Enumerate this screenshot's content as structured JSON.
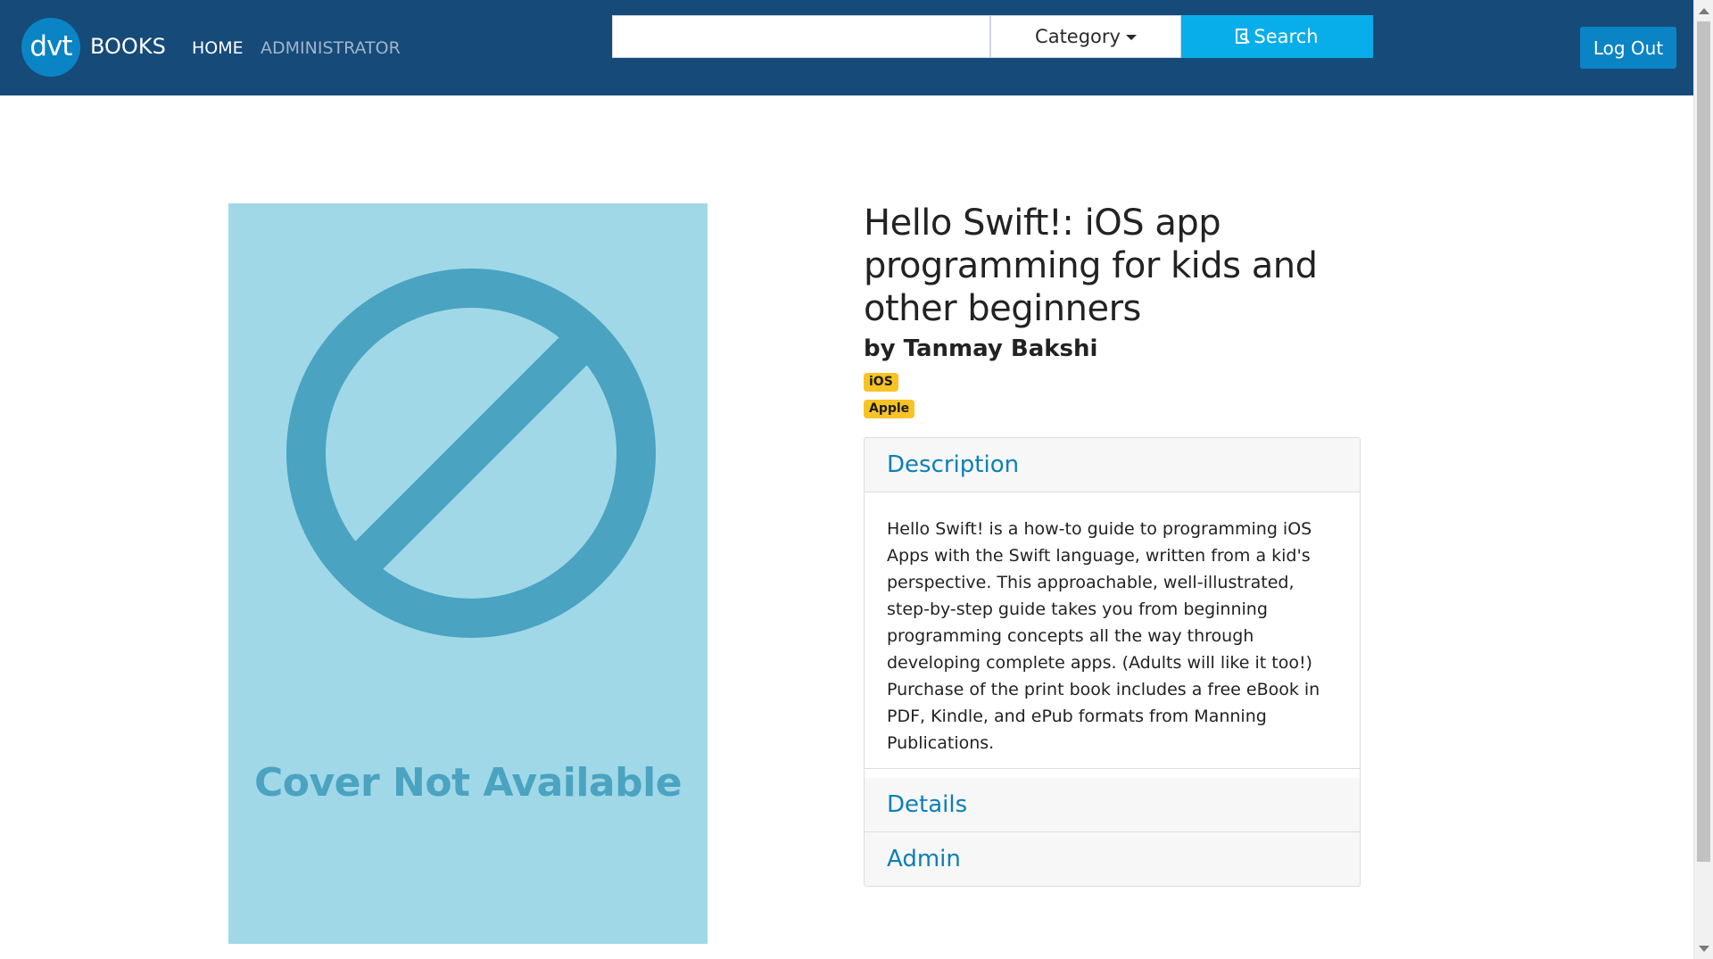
{
  "navbar": {
    "logo_text": "dvt",
    "brand": "BOOKS",
    "links": [
      {
        "label": "HOME"
      },
      {
        "label": "ADMINISTRATOR"
      }
    ],
    "search": {
      "value": "",
      "placeholder": "",
      "category_label": "Category",
      "button_label": "Search"
    },
    "logout_label": "Log Out",
    "colors": {
      "background": "#164a78",
      "search_button": "#08aeea",
      "logout_button": "#0b84c6"
    }
  },
  "book": {
    "cover_text": "Cover Not Available",
    "cover_icon": "no-entry-icon",
    "title": "Hello Swift!: iOS app programming for kids and other beginners",
    "author": "by Tanmay Bakshi",
    "tags": [
      "iOS",
      "Apple"
    ],
    "accordion": {
      "description_label": "Description",
      "description_text": "Hello Swift! is a how-to guide to programming iOS Apps with the Swift language, written from a kid's perspective. This approachable, well-illustrated, step-by-step guide takes you from beginning programming concepts all the way through developing complete apps. (Adults will like it too!) Purchase of the print book includes a free eBook in PDF, Kindle, and ePub formats from Manning Publications.",
      "details_label": "Details",
      "admin_label": "Admin"
    },
    "colors": {
      "tag": "#f7c325",
      "accordion_header_text": "#0b7fb8",
      "cover_background": "#a0d8e8",
      "cover_foreground": "#4aa3c0"
    }
  }
}
